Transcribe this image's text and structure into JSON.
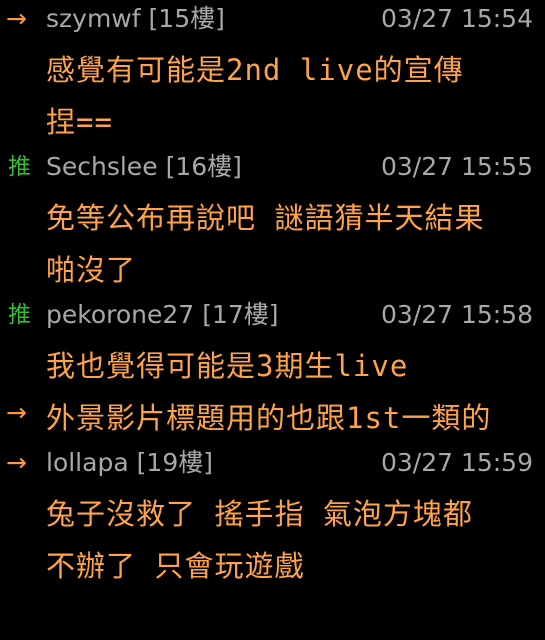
{
  "colors": {
    "background": "#000000",
    "meta_text": "#a8a8a8",
    "content_text": "#ffa34a",
    "arrow_tag": "#ff9a3c",
    "push_tag": "#2fbf2f"
  },
  "comments": [
    {
      "tag": "→",
      "tag_type": "arrow",
      "user": "szymwf",
      "floor": "[15樓]",
      "time": "03/27 15:54",
      "lines": [
        "感覺有可能是2nd live的宣傳",
        "捏=="
      ]
    },
    {
      "tag": "推",
      "tag_type": "push",
      "user": "Sechslee",
      "floor": "[16樓]",
      "time": "03/27 15:55",
      "lines": [
        "免等公布再說吧 謎語猜半天結果",
        "啪沒了"
      ]
    },
    {
      "tag": "推",
      "tag_type": "push",
      "user": "pekorone27",
      "floor": "[17樓]",
      "time": "03/27 15:58",
      "lines": [
        "我也覺得可能是3期生live"
      ]
    },
    {
      "tag": "→",
      "tag_type": "arrow",
      "continuation": "外景影片標題用的也跟1st一類的"
    },
    {
      "tag": "→",
      "tag_type": "arrow",
      "user": "lollapa",
      "floor": "[19樓]",
      "time": "03/27 15:59",
      "lines": [
        "兔子沒救了 搖手指 氣泡方塊都",
        "不辦了 只會玩遊戲"
      ]
    }
  ]
}
